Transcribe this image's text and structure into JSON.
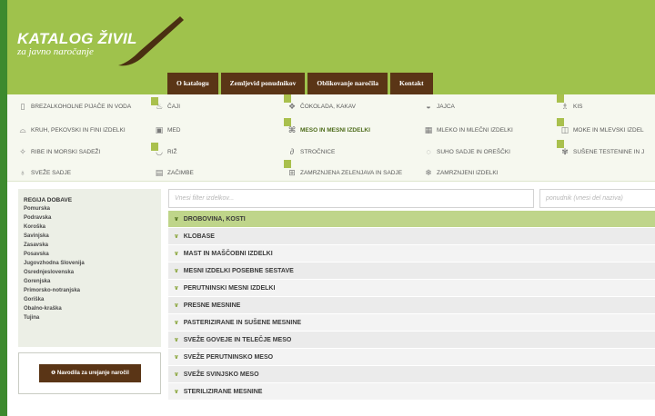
{
  "logo": {
    "title": "KATALOG ŽIVIL",
    "subtitle": "za javno naročanje"
  },
  "nav": [
    {
      "label": "O katalogu"
    },
    {
      "label": "Zemljevid ponudnikov"
    },
    {
      "label": "Oblikovanje naročila"
    },
    {
      "label": "Kontakt"
    }
  ],
  "categories": [
    {
      "label": "Brezalkoholne pijače in voda",
      "icon": "bottle-icon"
    },
    {
      "label": "Kruh, pekovski in fini izdelki",
      "icon": "bread-icon"
    },
    {
      "label": "Ribe in morski sadeži",
      "icon": "fish-icon"
    },
    {
      "label": "Sveže sadje",
      "icon": "fruit-icon"
    },
    {
      "label": "Čaji",
      "icon": "tea-icon"
    },
    {
      "label": "Med",
      "icon": "honey-icon"
    },
    {
      "label": "Riž",
      "icon": "rice-icon"
    },
    {
      "label": "Začimbe",
      "icon": "spice-icon"
    },
    {
      "label": "Čokolada, kakav",
      "icon": "chocolate-icon"
    },
    {
      "label": "Meso in mesni izdelki",
      "icon": "meat-icon"
    },
    {
      "label": "Stročnice",
      "icon": "legume-icon"
    },
    {
      "label": "Zamrznjena zelenjava in sadje",
      "icon": "frozen-veg-icon"
    },
    {
      "label": "Jajca",
      "icon": "egg-icon"
    },
    {
      "label": "Mleko in mlečni izdelki",
      "icon": "milk-icon"
    },
    {
      "label": "Suho sadje in oreščki",
      "icon": "nut-icon"
    },
    {
      "label": "Zamrznjeni izdelki",
      "icon": "snowflake-icon"
    },
    {
      "label": "Kis",
      "icon": "vinegar-icon"
    },
    {
      "label": "Moke in mlevski izdel",
      "icon": "flour-icon"
    },
    {
      "label": "Sušene testenine in j",
      "icon": "pasta-icon"
    }
  ],
  "sidebar": {
    "title": "REGIJA DOBAVE",
    "regions": [
      "Pomurska",
      "Podravska",
      "Koroška",
      "Savinjska",
      "Zasavska",
      "Posavska",
      "Jugovzhodna Slovenija",
      "Osrednjeslovenska",
      "Gorenjska",
      "Primorsko-notranjska",
      "Goriška",
      "Obalno-kraška",
      "Tujina"
    ],
    "guide_button": "Navodila za urejanje naročil"
  },
  "filters": {
    "product_placeholder": "Vnesi filter izdelkov...",
    "supplier_placeholder": "ponudnik (vnesi del naziva)"
  },
  "subcategories": [
    "Drobovina, kosti",
    "Klobase",
    "Mast in maščobni izdelki",
    "Mesni izdelki posebne sestave",
    "Perutninski mesni izdelki",
    "Presne mesnine",
    "Pasterizirane in sušene mesnine",
    "Sveže goveje in telečje meso",
    "Sveže perutninsko meso",
    "Sveže svinjsko meso",
    "Sterilizirane mesnine"
  ],
  "colors": {
    "brand_green": "#9fc24c",
    "nav_brown": "#5a3516",
    "page_green": "#3d8a2e"
  }
}
